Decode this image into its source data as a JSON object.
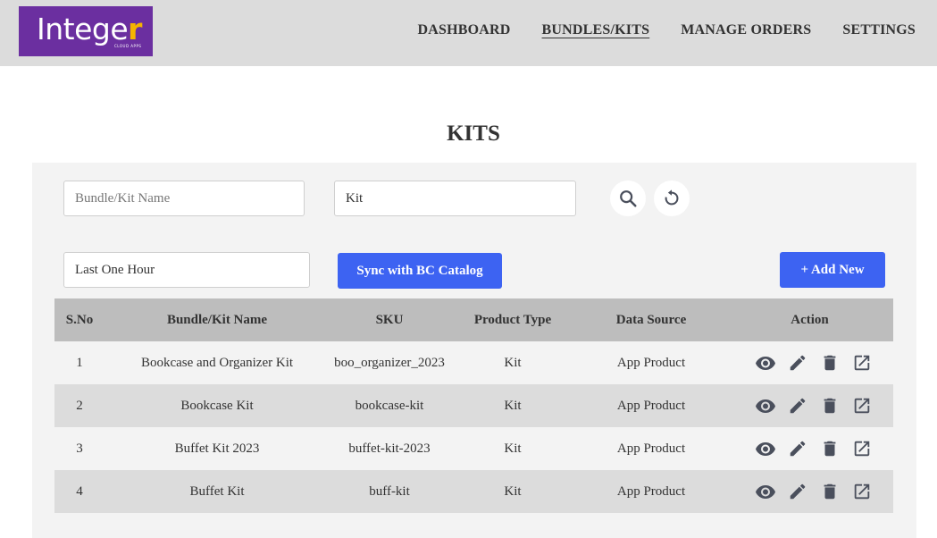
{
  "header": {
    "logo": {
      "text_main": "Intege",
      "text_accent": "r",
      "subtitle": "CLOUD APPS"
    },
    "nav": [
      {
        "label": "DASHBOARD",
        "active": false
      },
      {
        "label": "BUNDLES/KITS",
        "active": true
      },
      {
        "label": "MANAGE ORDERS",
        "active": false
      },
      {
        "label": "SETTINGS",
        "active": false
      }
    ]
  },
  "page": {
    "title": "KITS"
  },
  "filters": {
    "name_field": {
      "placeholder": "Bundle/Kit Name",
      "value": ""
    },
    "type_field": {
      "value": "Kit"
    },
    "time_field": {
      "value": "Last One Hour"
    },
    "search_icon": "search-icon",
    "reset_icon": "reset-icon",
    "sync_label": "Sync with BC Catalog",
    "add_label": "+ Add New"
  },
  "colors": {
    "accent": "#3d63f2",
    "brand": "#6b2fa0",
    "brand_accent": "#f5b400",
    "icon": "#4a4f5c"
  },
  "table": {
    "headers": [
      "S.No",
      "Bundle/Kit Name",
      "SKU",
      "Product Type",
      "Data Source",
      "Action"
    ],
    "rows": [
      {
        "sno": "1",
        "name": "Bookcase and Organizer Kit",
        "sku": "boo_organizer_2023",
        "type": "Kit",
        "source": "App Product"
      },
      {
        "sno": "2",
        "name": "Bookcase Kit",
        "sku": "bookcase-kit",
        "type": "Kit",
        "source": "App Product"
      },
      {
        "sno": "3",
        "name": "Buffet Kit 2023",
        "sku": "buffet-kit-2023",
        "type": "Kit",
        "source": "App Product"
      },
      {
        "sno": "4",
        "name": "Buffet Kit",
        "sku": "buff-kit",
        "type": "Kit",
        "source": "App Product"
      }
    ],
    "action_icons": [
      "view-icon",
      "edit-icon",
      "delete-icon",
      "open-external-icon"
    ]
  }
}
